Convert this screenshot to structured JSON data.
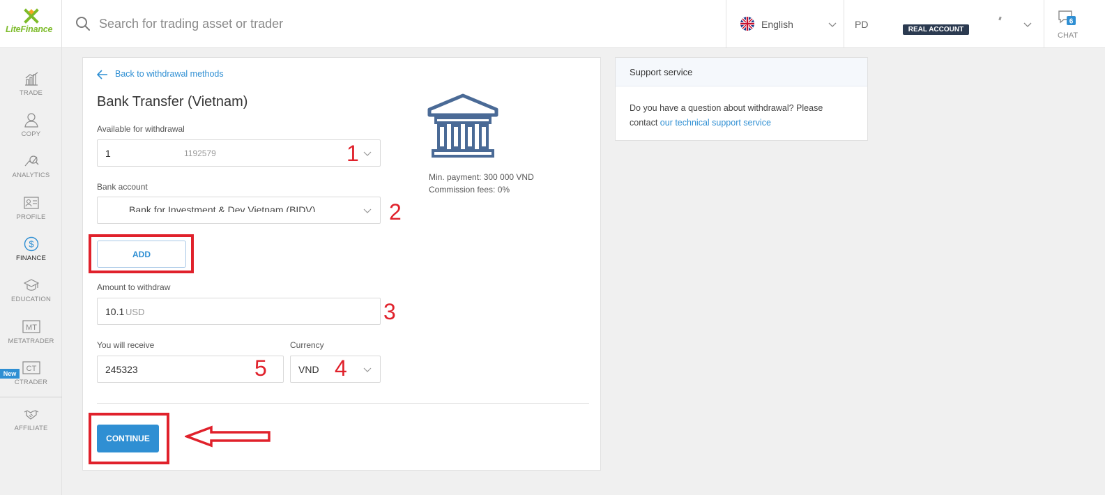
{
  "brand": {
    "logo_text": "LiteFinance"
  },
  "header": {
    "search_placeholder": "Search for trading asset or trader",
    "language": "English",
    "account_initials": "PD",
    "account_badge": "REAL ACCOUNT",
    "chat_label": "CHAT",
    "chat_count": "6"
  },
  "sidebar": {
    "items": [
      {
        "label": "TRADE",
        "icon": "trade-chart-icon"
      },
      {
        "label": "COPY",
        "icon": "copy-trader-icon"
      },
      {
        "label": "ANALYTICS",
        "icon": "analytics-icon"
      },
      {
        "label": "PROFILE",
        "icon": "profile-card-icon"
      },
      {
        "label": "FINANCE",
        "icon": "dollar-coin-icon",
        "active": true
      },
      {
        "label": "EDUCATION",
        "icon": "graduation-cap-icon"
      },
      {
        "label": "METATRADER",
        "icon": "mt-icon",
        "icon_text": "MT"
      },
      {
        "label": "CTRADER",
        "icon": "ct-icon",
        "icon_text": "CT",
        "badge": "New"
      },
      {
        "label": "AFFILIATE",
        "icon": "handshake-icon"
      }
    ]
  },
  "withdrawal": {
    "back_link": "Back to withdrawal methods",
    "method_title": "Bank Transfer (Vietnam)",
    "available_label": "Available for withdrawal",
    "account_number": "1",
    "account_id": "1192579",
    "bank_account_label": "Bank account",
    "bank_account_value": "Bank for Investment & Dev Vietnam (BIDV)",
    "add_button": "ADD",
    "amount_label": "Amount to withdraw",
    "amount_value": "10.1",
    "amount_currency": "USD",
    "receive_label": "You will receive",
    "receive_value": "245323",
    "currency_label": "Currency",
    "currency_value": "VND",
    "continue_button": "CONTINUE",
    "min_payment": "Min. payment: 300 000 VND",
    "commission": "Commission fees: 0%"
  },
  "support": {
    "title": "Support service",
    "text": "Do you have a question about withdrawal? Please contact",
    "link": "our technical support service"
  },
  "annotations": {
    "n1": "1",
    "n2": "2",
    "n3": "3",
    "n4": "4",
    "n5": "5",
    "color": "#e0212b"
  },
  "colors": {
    "accent": "#2f8fd3",
    "brand_green": "#7dbb2a",
    "badge_dark": "#2b3a50",
    "annotation_red": "#e0212b"
  }
}
